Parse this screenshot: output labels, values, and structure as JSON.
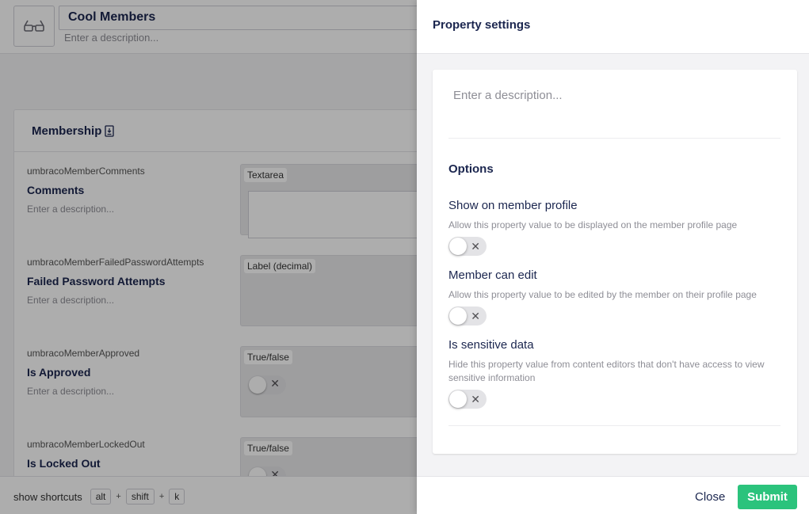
{
  "background": {
    "header": {
      "name_value": "Cool Members",
      "description_placeholder": "Enter a description...",
      "icon": "glasses-icon"
    },
    "group": {
      "title": "Membership",
      "icon": "lock-icon",
      "properties": [
        {
          "alias": "umbracoMemberComments",
          "name": "Comments",
          "description": "Enter a description...",
          "editor": "Textarea"
        },
        {
          "alias": "umbracoMemberFailedPasswordAttempts",
          "name": "Failed Password Attempts",
          "description": "Enter a description...",
          "editor": "Label (decimal)"
        },
        {
          "alias": "umbracoMemberApproved",
          "name": "Is Approved",
          "description": "Enter a description...",
          "editor": "True/false"
        },
        {
          "alias": "umbracoMemberLockedOut",
          "name": "Is Locked Out",
          "description": "",
          "editor": "True/false"
        }
      ]
    },
    "shortcuts": {
      "label": "show shortcuts",
      "keys": [
        "alt",
        "shift",
        "k"
      ]
    }
  },
  "panel": {
    "title": "Property settings",
    "description_placeholder": "Enter a description...",
    "options_title": "Options",
    "options": [
      {
        "label": "Show on member profile",
        "help": "Allow this property value to be displayed on the member profile page",
        "enabled": false
      },
      {
        "label": "Member can edit",
        "help": "Allow this property value to be edited by the member on their profile page",
        "enabled": false
      },
      {
        "label": "Is sensitive data",
        "help": "Hide this property value from content editors that don't have access to view sensitive information",
        "enabled": false
      }
    ],
    "toggle_off_glyph": "✕",
    "close_label": "Close",
    "submit_label": "Submit",
    "colors": {
      "submit": "#2bc37c",
      "toggle_off": "#e3e3e6"
    }
  }
}
